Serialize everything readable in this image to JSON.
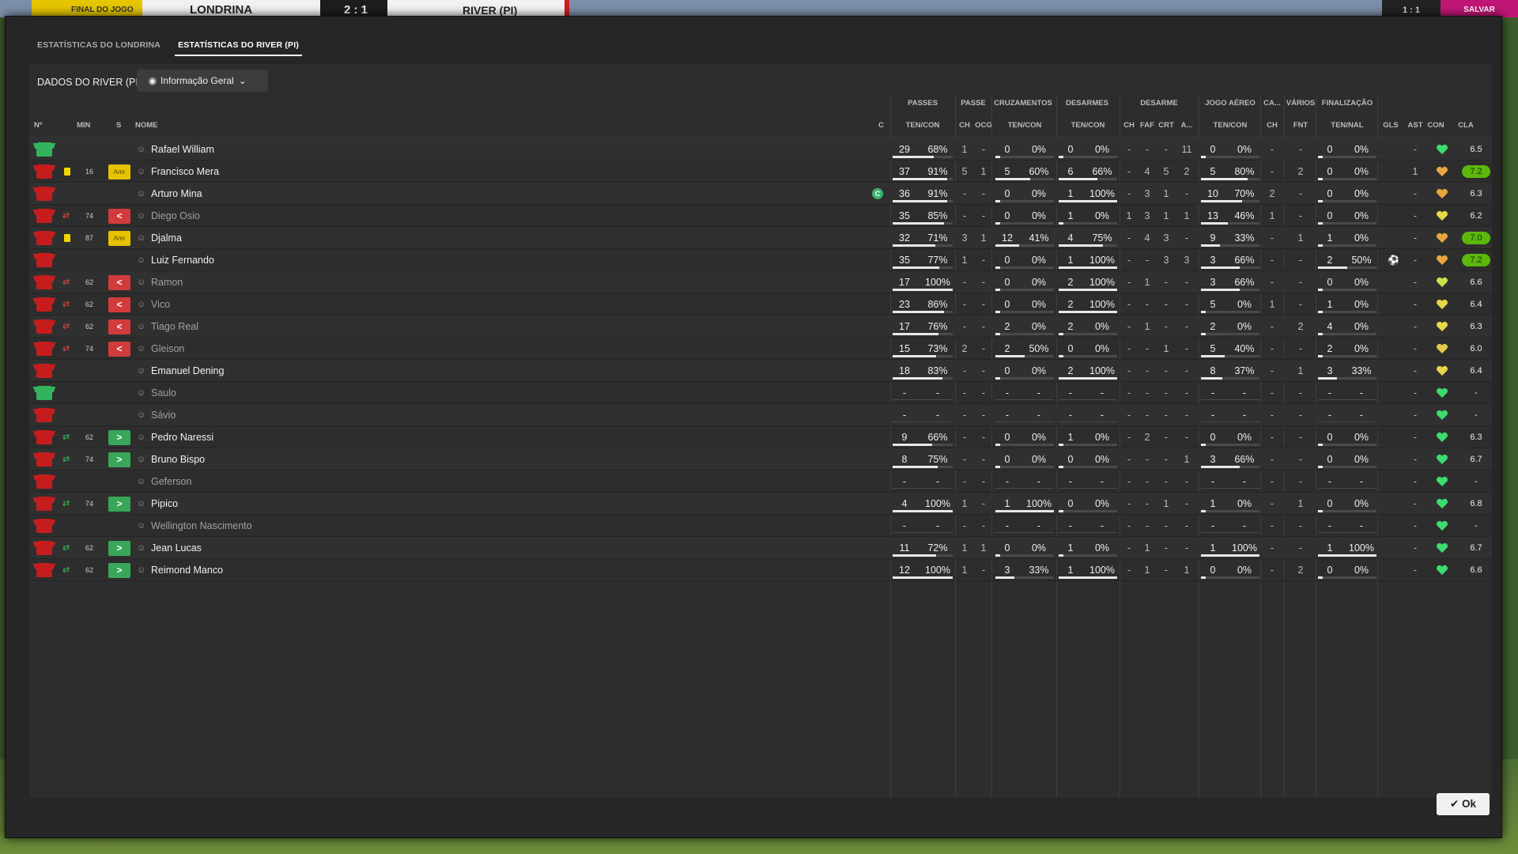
{
  "topbar": {
    "status": "FINAL DO JOGO",
    "home": "LONDRINA",
    "score": "2 : 1",
    "away": "RIVER (PI)",
    "right_a": "1 : 1",
    "right_b": "SALVAR"
  },
  "tabs": [
    {
      "label": "ESTATÍSTICAS DO LONDRINA",
      "active": false
    },
    {
      "label": "ESTATÍSTICAS DO RIVER (PI)",
      "active": true
    }
  ],
  "panel": {
    "label": "DADOS DO RIVER (PI)",
    "dropdown": "Informação Geral"
  },
  "columns": {
    "left": [
      "Nº",
      "MIN",
      "S",
      "NOME",
      "C"
    ],
    "groups": [
      "PASSES",
      "PASSE",
      "CRUZAMENTOS",
      "DESARMES",
      "DESARME",
      "JOGO AÉREO",
      "CA...",
      "VÁRIOS",
      "FINALIZAÇÃO"
    ],
    "sub": [
      "TEN/CON",
      "CH",
      "OCG",
      "TEN/CON",
      "TEN/CON",
      "CH",
      "FAF",
      "CRT",
      "A...",
      "TEN/CON",
      "CH",
      "FNT",
      "TEN/NAL",
      "GLS",
      "AST",
      "CON",
      "CLA"
    ]
  },
  "players": [
    {
      "shirt": "green",
      "card": "",
      "ev": "",
      "min": "",
      "badge": "",
      "name": "Rafael William",
      "dim": false,
      "cap": false,
      "pas": [
        "29",
        "68%"
      ],
      "pch": "1",
      "ocg": "-",
      "cru": [
        "0",
        "0%"
      ],
      "des": [
        "0",
        "0%"
      ],
      "dch": "-",
      "faf": "-",
      "crt": "-",
      "da": "11",
      "aer": [
        "0",
        "0%"
      ],
      "cch": "-",
      "fnt": "-",
      "fin": [
        "0",
        "0%"
      ],
      "gls": "",
      "ast": "-",
      "con": "#3ddc6e",
      "cla": "6.5",
      "hi": false
    },
    {
      "shirt": "red",
      "card": "y",
      "ev": "",
      "min": "16",
      "badge": "Amr",
      "name": "Francisco Mera",
      "dim": false,
      "cap": false,
      "pas": [
        "37",
        "91%"
      ],
      "pch": "5",
      "ocg": "1",
      "cru": [
        "5",
        "60%"
      ],
      "des": [
        "6",
        "66%"
      ],
      "dch": "-",
      "faf": "4",
      "crt": "5",
      "da": "2",
      "aer": [
        "5",
        "80%"
      ],
      "cch": "-",
      "fnt": "2",
      "fin": [
        "0",
        "0%"
      ],
      "gls": "",
      "ast": "1",
      "con": "#e8a640",
      "cla": "7.2",
      "hi": true
    },
    {
      "shirt": "red",
      "card": "",
      "ev": "",
      "min": "",
      "badge": "",
      "name": "Arturo Mina",
      "dim": false,
      "cap": true,
      "pas": [
        "36",
        "91%"
      ],
      "pch": "-",
      "ocg": "-",
      "cru": [
        "0",
        "0%"
      ],
      "des": [
        "1",
        "100%"
      ],
      "dch": "-",
      "faf": "3",
      "crt": "1",
      "da": "-",
      "aer": [
        "10",
        "70%"
      ],
      "cch": "2",
      "fnt": "-",
      "fin": [
        "0",
        "0%"
      ],
      "gls": "",
      "ast": "-",
      "con": "#e8a640",
      "cla": "6.3",
      "hi": false
    },
    {
      "shirt": "red",
      "card": "",
      "ev": "out",
      "min": "74",
      "badge": "<",
      "name": "Diego Osio",
      "dim": true,
      "cap": false,
      "pas": [
        "35",
        "85%"
      ],
      "pch": "-",
      "ocg": "-",
      "cru": [
        "0",
        "0%"
      ],
      "des": [
        "1",
        "0%"
      ],
      "dch": "1",
      "faf": "3",
      "crt": "1",
      "da": "1",
      "aer": [
        "13",
        "46%"
      ],
      "cch": "1",
      "fnt": "-",
      "fin": [
        "0",
        "0%"
      ],
      "gls": "",
      "ast": "-",
      "con": "#e6d84a",
      "cla": "6.2",
      "hi": false
    },
    {
      "shirt": "red",
      "card": "y",
      "ev": "",
      "min": "87",
      "badge": "Amr",
      "name": "Djalma",
      "dim": false,
      "cap": false,
      "pas": [
        "32",
        "71%"
      ],
      "pch": "3",
      "ocg": "1",
      "cru": [
        "12",
        "41%"
      ],
      "des": [
        "4",
        "75%"
      ],
      "dch": "-",
      "faf": "4",
      "crt": "3",
      "da": "-",
      "aer": [
        "9",
        "33%"
      ],
      "cch": "-",
      "fnt": "1",
      "fin": [
        "1",
        "0%"
      ],
      "gls": "",
      "ast": "-",
      "con": "#e8a640",
      "cla": "7.0",
      "hi": true
    },
    {
      "shirt": "red",
      "card": "",
      "ev": "",
      "min": "",
      "badge": "",
      "name": "Luiz Fernando",
      "dim": false,
      "cap": false,
      "pas": [
        "35",
        "77%"
      ],
      "pch": "1",
      "ocg": "-",
      "cru": [
        "0",
        "0%"
      ],
      "des": [
        "1",
        "100%"
      ],
      "dch": "-",
      "faf": "-",
      "crt": "3",
      "da": "3",
      "aer": [
        "3",
        "66%"
      ],
      "cch": "-",
      "fnt": "-",
      "fin": [
        "2",
        "50%"
      ],
      "gls": "⚽",
      "ast": "-",
      "con": "#e8a640",
      "cla": "7.2",
      "hi": true
    },
    {
      "shirt": "red",
      "card": "",
      "ev": "out",
      "min": "62",
      "badge": "<",
      "name": "Ramon",
      "dim": true,
      "cap": false,
      "pas": [
        "17",
        "100%"
      ],
      "pch": "-",
      "ocg": "-",
      "cru": [
        "0",
        "0%"
      ],
      "des": [
        "2",
        "100%"
      ],
      "dch": "-",
      "faf": "1",
      "crt": "-",
      "da": "-",
      "aer": [
        "3",
        "66%"
      ],
      "cch": "-",
      "fnt": "-",
      "fin": [
        "0",
        "0%"
      ],
      "gls": "",
      "ast": "-",
      "con": "#c8e04a",
      "cla": "6.6",
      "hi": false
    },
    {
      "shirt": "red",
      "card": "",
      "ev": "out",
      "min": "62",
      "badge": "<",
      "name": "Vico",
      "dim": true,
      "cap": false,
      "pas": [
        "23",
        "86%"
      ],
      "pch": "-",
      "ocg": "-",
      "cru": [
        "0",
        "0%"
      ],
      "des": [
        "2",
        "100%"
      ],
      "dch": "-",
      "faf": "-",
      "crt": "-",
      "da": "-",
      "aer": [
        "5",
        "0%"
      ],
      "cch": "1",
      "fnt": "-",
      "fin": [
        "1",
        "0%"
      ],
      "gls": "",
      "ast": "-",
      "con": "#e6d84a",
      "cla": "6.4",
      "hi": false
    },
    {
      "shirt": "red",
      "card": "",
      "ev": "out",
      "min": "62",
      "badge": "<",
      "name": "Tiago Real",
      "dim": true,
      "cap": false,
      "pas": [
        "17",
        "76%"
      ],
      "pch": "-",
      "ocg": "-",
      "cru": [
        "2",
        "0%"
      ],
      "des": [
        "2",
        "0%"
      ],
      "dch": "-",
      "faf": "1",
      "crt": "-",
      "da": "-",
      "aer": [
        "2",
        "0%"
      ],
      "cch": "-",
      "fnt": "2",
      "fin": [
        "4",
        "0%"
      ],
      "gls": "",
      "ast": "-",
      "con": "#e6d84a",
      "cla": "6.3",
      "hi": false
    },
    {
      "shirt": "red",
      "card": "",
      "ev": "out",
      "min": "74",
      "badge": "<",
      "name": "Gleison",
      "dim": true,
      "cap": false,
      "pas": [
        "15",
        "73%"
      ],
      "pch": "2",
      "ocg": "-",
      "cru": [
        "2",
        "50%"
      ],
      "des": [
        "0",
        "0%"
      ],
      "dch": "-",
      "faf": "-",
      "crt": "1",
      "da": "-",
      "aer": [
        "5",
        "40%"
      ],
      "cch": "-",
      "fnt": "-",
      "fin": [
        "2",
        "0%"
      ],
      "gls": "",
      "ast": "-",
      "con": "#e6c84a",
      "cla": "6.0",
      "hi": false
    },
    {
      "shirt": "red",
      "card": "",
      "ev": "",
      "min": "",
      "badge": "",
      "name": "Emanuel Dening",
      "dim": false,
      "cap": false,
      "pas": [
        "18",
        "83%"
      ],
      "pch": "-",
      "ocg": "-",
      "cru": [
        "0",
        "0%"
      ],
      "des": [
        "2",
        "100%"
      ],
      "dch": "-",
      "faf": "-",
      "crt": "-",
      "da": "-",
      "aer": [
        "8",
        "37%"
      ],
      "cch": "-",
      "fnt": "1",
      "fin": [
        "3",
        "33%"
      ],
      "gls": "",
      "ast": "-",
      "con": "#e6d84a",
      "cla": "6.4",
      "hi": false
    },
    {
      "shirt": "green",
      "card": "",
      "ev": "",
      "min": "",
      "badge": "",
      "name": "Saulo",
      "dim": true,
      "cap": false,
      "pas": [
        "-",
        "-"
      ],
      "pch": "-",
      "ocg": "-",
      "cru": [
        "-",
        "-"
      ],
      "des": [
        "-",
        "-"
      ],
      "dch": "-",
      "faf": "-",
      "crt": "-",
      "da": "-",
      "aer": [
        "-",
        "-"
      ],
      "cch": "-",
      "fnt": "-",
      "fin": [
        "-",
        "-"
      ],
      "gls": "",
      "ast": "-",
      "con": "#3ddc6e",
      "cla": "-",
      "hi": false
    },
    {
      "shirt": "red",
      "card": "",
      "ev": "",
      "min": "",
      "badge": "",
      "name": "Sávio",
      "dim": true,
      "cap": false,
      "pas": [
        "-",
        "-"
      ],
      "pch": "-",
      "ocg": "-",
      "cru": [
        "-",
        "-"
      ],
      "des": [
        "-",
        "-"
      ],
      "dch": "-",
      "faf": "-",
      "crt": "-",
      "da": "-",
      "aer": [
        "-",
        "-"
      ],
      "cch": "-",
      "fnt": "-",
      "fin": [
        "-",
        "-"
      ],
      "gls": "",
      "ast": "-",
      "con": "#3ddc6e",
      "cla": "-",
      "hi": false
    },
    {
      "shirt": "red",
      "card": "",
      "ev": "in",
      "min": "62",
      "badge": ">",
      "name": "Pedro Naressi",
      "dim": false,
      "cap": false,
      "pas": [
        "9",
        "66%"
      ],
      "pch": "-",
      "ocg": "-",
      "cru": [
        "0",
        "0%"
      ],
      "des": [
        "1",
        "0%"
      ],
      "dch": "-",
      "faf": "2",
      "crt": "-",
      "da": "-",
      "aer": [
        "0",
        "0%"
      ],
      "cch": "-",
      "fnt": "-",
      "fin": [
        "0",
        "0%"
      ],
      "gls": "",
      "ast": "-",
      "con": "#3ddc6e",
      "cla": "6.3",
      "hi": false
    },
    {
      "shirt": "red",
      "card": "",
      "ev": "in",
      "min": "74",
      "badge": ">",
      "name": "Bruno Bispo",
      "dim": false,
      "cap": false,
      "pas": [
        "8",
        "75%"
      ],
      "pch": "-",
      "ocg": "-",
      "cru": [
        "0",
        "0%"
      ],
      "des": [
        "0",
        "0%"
      ],
      "dch": "-",
      "faf": "-",
      "crt": "-",
      "da": "1",
      "aer": [
        "3",
        "66%"
      ],
      "cch": "-",
      "fnt": "-",
      "fin": [
        "0",
        "0%"
      ],
      "gls": "",
      "ast": "-",
      "con": "#3ddc6e",
      "cla": "6.7",
      "hi": false
    },
    {
      "shirt": "red",
      "card": "",
      "ev": "",
      "min": "",
      "badge": "",
      "name": "Geferson",
      "dim": true,
      "cap": false,
      "pas": [
        "-",
        "-"
      ],
      "pch": "-",
      "ocg": "-",
      "cru": [
        "-",
        "-"
      ],
      "des": [
        "-",
        "-"
      ],
      "dch": "-",
      "faf": "-",
      "crt": "-",
      "da": "-",
      "aer": [
        "-",
        "-"
      ],
      "cch": "-",
      "fnt": "-",
      "fin": [
        "-",
        "-"
      ],
      "gls": "",
      "ast": "-",
      "con": "#3ddc6e",
      "cla": "-",
      "hi": false
    },
    {
      "shirt": "red",
      "card": "",
      "ev": "in",
      "min": "74",
      "badge": ">",
      "name": "Pipico",
      "dim": false,
      "cap": false,
      "pas": [
        "4",
        "100%"
      ],
      "pch": "1",
      "ocg": "-",
      "cru": [
        "1",
        "100%"
      ],
      "des": [
        "0",
        "0%"
      ],
      "dch": "-",
      "faf": "-",
      "crt": "1",
      "da": "-",
      "aer": [
        "1",
        "0%"
      ],
      "cch": "-",
      "fnt": "1",
      "fin": [
        "0",
        "0%"
      ],
      "gls": "",
      "ast": "-",
      "con": "#3ddc6e",
      "cla": "6.8",
      "hi": false
    },
    {
      "shirt": "red",
      "card": "",
      "ev": "",
      "min": "",
      "badge": "",
      "name": "Wellington Nascimento",
      "dim": true,
      "cap": false,
      "pas": [
        "-",
        "-"
      ],
      "pch": "-",
      "ocg": "-",
      "cru": [
        "-",
        "-"
      ],
      "des": [
        "-",
        "-"
      ],
      "dch": "-",
      "faf": "-",
      "crt": "-",
      "da": "-",
      "aer": [
        "-",
        "-"
      ],
      "cch": "-",
      "fnt": "-",
      "fin": [
        "-",
        "-"
      ],
      "gls": "",
      "ast": "-",
      "con": "#3ddc6e",
      "cla": "-",
      "hi": false
    },
    {
      "shirt": "red",
      "card": "",
      "ev": "in",
      "min": "62",
      "badge": ">",
      "name": "Jean Lucas",
      "dim": false,
      "cap": false,
      "pas": [
        "11",
        "72%"
      ],
      "pch": "1",
      "ocg": "1",
      "cru": [
        "0",
        "0%"
      ],
      "des": [
        "1",
        "0%"
      ],
      "dch": "-",
      "faf": "1",
      "crt": "-",
      "da": "-",
      "aer": [
        "1",
        "100%"
      ],
      "cch": "-",
      "fnt": "-",
      "fin": [
        "1",
        "100%"
      ],
      "gls": "",
      "ast": "-",
      "con": "#3ddc6e",
      "cla": "6.7",
      "hi": false
    },
    {
      "shirt": "red",
      "card": "",
      "ev": "in",
      "min": "62",
      "badge": ">",
      "name": "Reimond Manco",
      "dim": false,
      "cap": false,
      "pas": [
        "12",
        "100%"
      ],
      "pch": "1",
      "ocg": "-",
      "cru": [
        "3",
        "33%"
      ],
      "des": [
        "1",
        "100%"
      ],
      "dch": "-",
      "faf": "1",
      "crt": "-",
      "da": "1",
      "aer": [
        "0",
        "0%"
      ],
      "cch": "-",
      "fnt": "2",
      "fin": [
        "0",
        "0%"
      ],
      "gls": "",
      "ast": "-",
      "con": "#3ddc6e",
      "cla": "6.6",
      "hi": false
    }
  ],
  "ok_label": "Ok"
}
